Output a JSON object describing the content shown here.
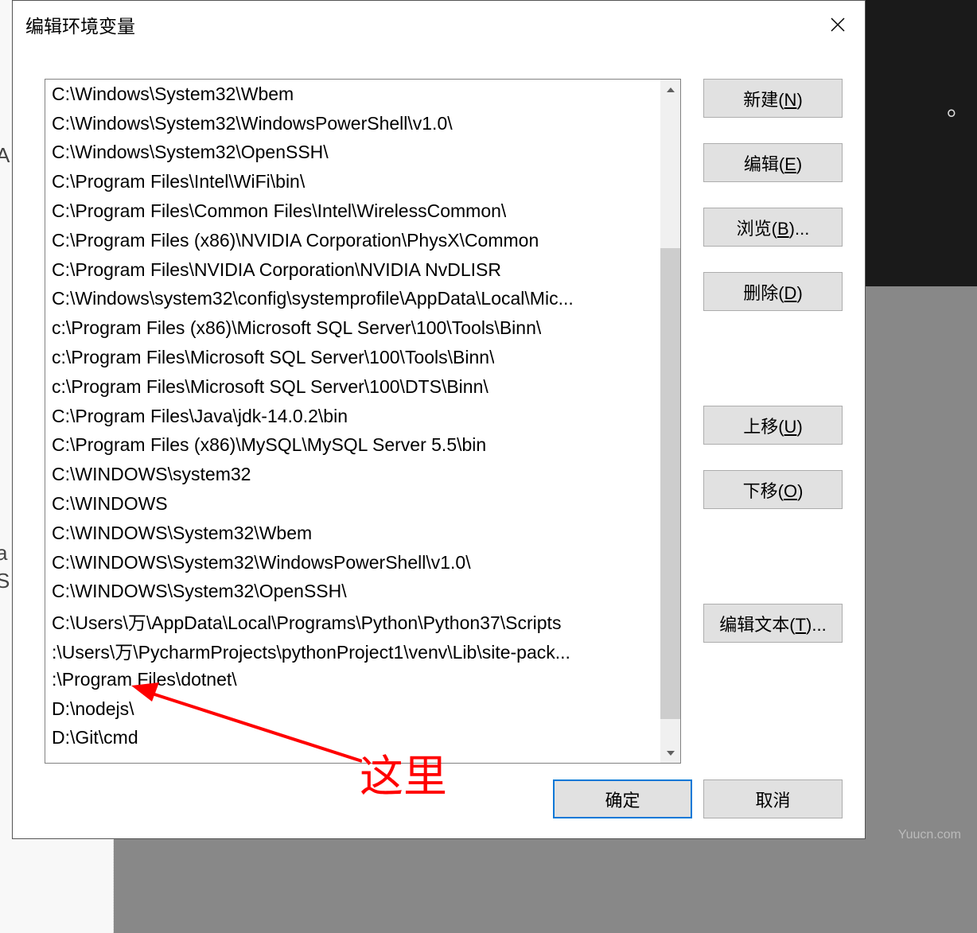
{
  "dialog": {
    "title": "编辑环境变量",
    "close_icon": "close"
  },
  "paths": [
    "C:\\Windows\\System32\\Wbem",
    "C:\\Windows\\System32\\WindowsPowerShell\\v1.0\\",
    "C:\\Windows\\System32\\OpenSSH\\",
    "C:\\Program Files\\Intel\\WiFi\\bin\\",
    "C:\\Program Files\\Common Files\\Intel\\WirelessCommon\\",
    "C:\\Program Files (x86)\\NVIDIA Corporation\\PhysX\\Common",
    "C:\\Program Files\\NVIDIA Corporation\\NVIDIA NvDLISR",
    "C:\\Windows\\system32\\config\\systemprofile\\AppData\\Local\\Mic...",
    "c:\\Program Files (x86)\\Microsoft SQL Server\\100\\Tools\\Binn\\",
    "c:\\Program Files\\Microsoft SQL Server\\100\\Tools\\Binn\\",
    "c:\\Program Files\\Microsoft SQL Server\\100\\DTS\\Binn\\",
    "C:\\Program Files\\Java\\jdk-14.0.2\\bin",
    "C:\\Program Files (x86)\\MySQL\\MySQL Server 5.5\\bin",
    "C:\\WINDOWS\\system32",
    "C:\\WINDOWS",
    "C:\\WINDOWS\\System32\\Wbem",
    "C:\\WINDOWS\\System32\\WindowsPowerShell\\v1.0\\",
    "C:\\WINDOWS\\System32\\OpenSSH\\",
    "C:\\Users\\万\\AppData\\Local\\Programs\\Python\\Python37\\Scripts",
    ":\\Users\\万\\PycharmProjects\\pythonProject1\\venv\\Lib\\site-pack...",
    ":\\Program Files\\dotnet\\",
    "D:\\nodejs\\",
    "D:\\Git\\cmd"
  ],
  "buttons": {
    "new": "新建(N)",
    "edit": "编辑(E)",
    "browse": "浏览(B)...",
    "delete": "删除(D)",
    "moveup": "上移(U)",
    "movedown": "下移(O)",
    "edittext": "编辑文本(T)...",
    "ok": "确定",
    "cancel": "取消"
  },
  "annotation": "这里",
  "watermark": "Yuucn.com"
}
